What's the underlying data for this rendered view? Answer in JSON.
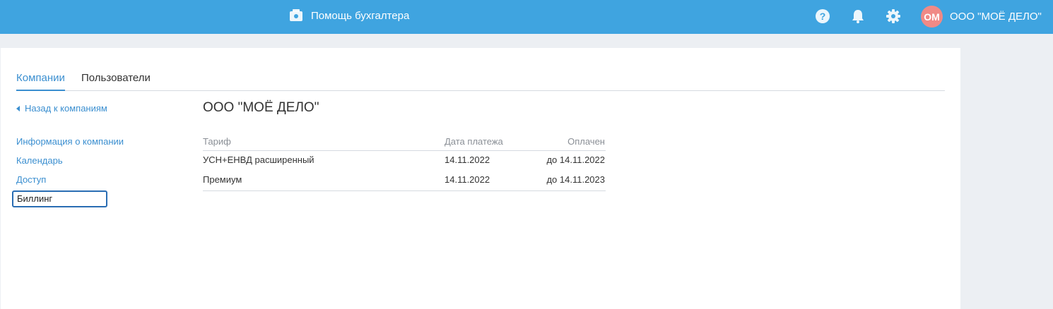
{
  "header": {
    "assistant_label": "Помощь бухгалтера",
    "user": {
      "initials": "ОМ",
      "name": "ООО \"МОЁ ДЕЛО\""
    },
    "colors": {
      "bar": "#3fa4e0",
      "avatar": "#f08a86"
    }
  },
  "tabs": [
    {
      "label": "Компании",
      "active": true
    },
    {
      "label": "Пользователи",
      "active": false
    }
  ],
  "back_link": "Назад к компаниям",
  "side_menu": [
    {
      "label": "Информация о компании",
      "selected": false
    },
    {
      "label": "Календарь",
      "selected": false
    },
    {
      "label": "Доступ",
      "selected": false
    },
    {
      "label": "Биллинг",
      "selected": true
    }
  ],
  "company_title": "ООО \"МОЁ ДЕЛО\"",
  "billing_table": {
    "headers": [
      "Тариф",
      "Дата платежа",
      "Оплачен"
    ],
    "rows": [
      [
        "УСН+ЕНВД расширенный",
        "14.11.2022",
        "до 14.11.2022"
      ],
      [
        "Премиум",
        "14.11.2022",
        "до 14.11.2023"
      ]
    ]
  }
}
